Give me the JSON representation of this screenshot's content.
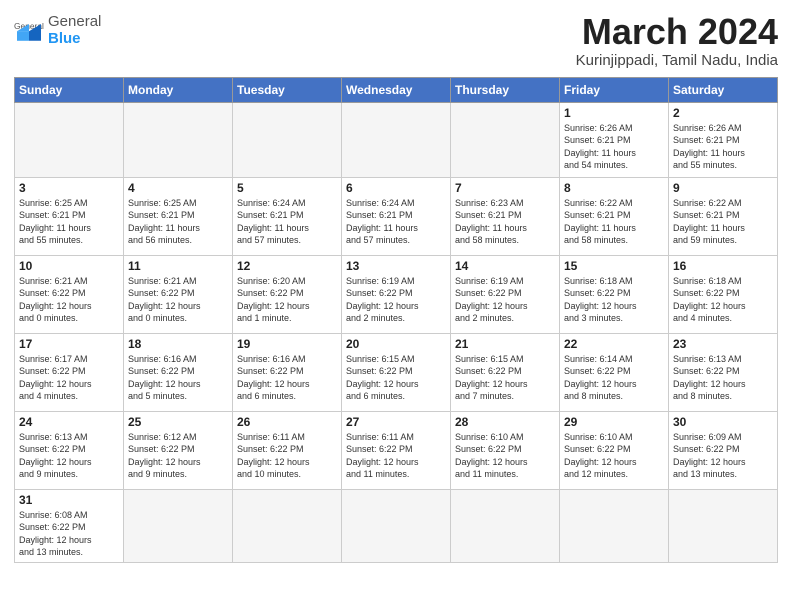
{
  "header": {
    "logo_general": "General",
    "logo_blue": "Blue",
    "title": "March 2024",
    "subtitle": "Kurinjippadi, Tamil Nadu, India"
  },
  "weekdays": [
    "Sunday",
    "Monday",
    "Tuesday",
    "Wednesday",
    "Thursday",
    "Friday",
    "Saturday"
  ],
  "weeks": [
    [
      {
        "day": "",
        "info": "",
        "empty": true
      },
      {
        "day": "",
        "info": "",
        "empty": true
      },
      {
        "day": "",
        "info": "",
        "empty": true
      },
      {
        "day": "",
        "info": "",
        "empty": true
      },
      {
        "day": "",
        "info": "",
        "empty": true
      },
      {
        "day": "1",
        "info": "Sunrise: 6:26 AM\nSunset: 6:21 PM\nDaylight: 11 hours\nand 54 minutes.",
        "empty": false
      },
      {
        "day": "2",
        "info": "Sunrise: 6:26 AM\nSunset: 6:21 PM\nDaylight: 11 hours\nand 55 minutes.",
        "empty": false
      }
    ],
    [
      {
        "day": "3",
        "info": "Sunrise: 6:25 AM\nSunset: 6:21 PM\nDaylight: 11 hours\nand 55 minutes.",
        "empty": false
      },
      {
        "day": "4",
        "info": "Sunrise: 6:25 AM\nSunset: 6:21 PM\nDaylight: 11 hours\nand 56 minutes.",
        "empty": false
      },
      {
        "day": "5",
        "info": "Sunrise: 6:24 AM\nSunset: 6:21 PM\nDaylight: 11 hours\nand 57 minutes.",
        "empty": false
      },
      {
        "day": "6",
        "info": "Sunrise: 6:24 AM\nSunset: 6:21 PM\nDaylight: 11 hours\nand 57 minutes.",
        "empty": false
      },
      {
        "day": "7",
        "info": "Sunrise: 6:23 AM\nSunset: 6:21 PM\nDaylight: 11 hours\nand 58 minutes.",
        "empty": false
      },
      {
        "day": "8",
        "info": "Sunrise: 6:22 AM\nSunset: 6:21 PM\nDaylight: 11 hours\nand 58 minutes.",
        "empty": false
      },
      {
        "day": "9",
        "info": "Sunrise: 6:22 AM\nSunset: 6:21 PM\nDaylight: 11 hours\nand 59 minutes.",
        "empty": false
      }
    ],
    [
      {
        "day": "10",
        "info": "Sunrise: 6:21 AM\nSunset: 6:22 PM\nDaylight: 12 hours\nand 0 minutes.",
        "empty": false
      },
      {
        "day": "11",
        "info": "Sunrise: 6:21 AM\nSunset: 6:22 PM\nDaylight: 12 hours\nand 0 minutes.",
        "empty": false
      },
      {
        "day": "12",
        "info": "Sunrise: 6:20 AM\nSunset: 6:22 PM\nDaylight: 12 hours\nand 1 minute.",
        "empty": false
      },
      {
        "day": "13",
        "info": "Sunrise: 6:19 AM\nSunset: 6:22 PM\nDaylight: 12 hours\nand 2 minutes.",
        "empty": false
      },
      {
        "day": "14",
        "info": "Sunrise: 6:19 AM\nSunset: 6:22 PM\nDaylight: 12 hours\nand 2 minutes.",
        "empty": false
      },
      {
        "day": "15",
        "info": "Sunrise: 6:18 AM\nSunset: 6:22 PM\nDaylight: 12 hours\nand 3 minutes.",
        "empty": false
      },
      {
        "day": "16",
        "info": "Sunrise: 6:18 AM\nSunset: 6:22 PM\nDaylight: 12 hours\nand 4 minutes.",
        "empty": false
      }
    ],
    [
      {
        "day": "17",
        "info": "Sunrise: 6:17 AM\nSunset: 6:22 PM\nDaylight: 12 hours\nand 4 minutes.",
        "empty": false
      },
      {
        "day": "18",
        "info": "Sunrise: 6:16 AM\nSunset: 6:22 PM\nDaylight: 12 hours\nand 5 minutes.",
        "empty": false
      },
      {
        "day": "19",
        "info": "Sunrise: 6:16 AM\nSunset: 6:22 PM\nDaylight: 12 hours\nand 6 minutes.",
        "empty": false
      },
      {
        "day": "20",
        "info": "Sunrise: 6:15 AM\nSunset: 6:22 PM\nDaylight: 12 hours\nand 6 minutes.",
        "empty": false
      },
      {
        "day": "21",
        "info": "Sunrise: 6:15 AM\nSunset: 6:22 PM\nDaylight: 12 hours\nand 7 minutes.",
        "empty": false
      },
      {
        "day": "22",
        "info": "Sunrise: 6:14 AM\nSunset: 6:22 PM\nDaylight: 12 hours\nand 8 minutes.",
        "empty": false
      },
      {
        "day": "23",
        "info": "Sunrise: 6:13 AM\nSunset: 6:22 PM\nDaylight: 12 hours\nand 8 minutes.",
        "empty": false
      }
    ],
    [
      {
        "day": "24",
        "info": "Sunrise: 6:13 AM\nSunset: 6:22 PM\nDaylight: 12 hours\nand 9 minutes.",
        "empty": false
      },
      {
        "day": "25",
        "info": "Sunrise: 6:12 AM\nSunset: 6:22 PM\nDaylight: 12 hours\nand 9 minutes.",
        "empty": false
      },
      {
        "day": "26",
        "info": "Sunrise: 6:11 AM\nSunset: 6:22 PM\nDaylight: 12 hours\nand 10 minutes.",
        "empty": false
      },
      {
        "day": "27",
        "info": "Sunrise: 6:11 AM\nSunset: 6:22 PM\nDaylight: 12 hours\nand 11 minutes.",
        "empty": false
      },
      {
        "day": "28",
        "info": "Sunrise: 6:10 AM\nSunset: 6:22 PM\nDaylight: 12 hours\nand 11 minutes.",
        "empty": false
      },
      {
        "day": "29",
        "info": "Sunrise: 6:10 AM\nSunset: 6:22 PM\nDaylight: 12 hours\nand 12 minutes.",
        "empty": false
      },
      {
        "day": "30",
        "info": "Sunrise: 6:09 AM\nSunset: 6:22 PM\nDaylight: 12 hours\nand 13 minutes.",
        "empty": false
      }
    ],
    [
      {
        "day": "31",
        "info": "Sunrise: 6:08 AM\nSunset: 6:22 PM\nDaylight: 12 hours\nand 13 minutes.",
        "empty": false
      },
      {
        "day": "",
        "info": "",
        "empty": true
      },
      {
        "day": "",
        "info": "",
        "empty": true
      },
      {
        "day": "",
        "info": "",
        "empty": true
      },
      {
        "day": "",
        "info": "",
        "empty": true
      },
      {
        "day": "",
        "info": "",
        "empty": true
      },
      {
        "day": "",
        "info": "",
        "empty": true
      }
    ]
  ]
}
